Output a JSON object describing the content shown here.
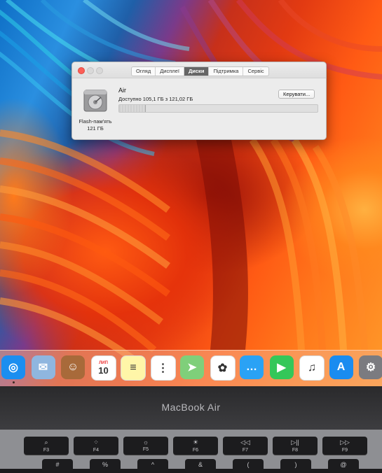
{
  "window": {
    "tabs": [
      "Огляд",
      "Дисплеї",
      "Диски",
      "Підтримка",
      "Сервіс"
    ],
    "active_tab_index": 2,
    "disk": {
      "caption_line1": "Flash-пам'ять",
      "caption_line2": "121 ГБ",
      "name": "Air",
      "available_text": "Доступно 105,1 ГБ з 121,02 ГБ",
      "manage_label": "Керувати...",
      "used_fraction": 0.13
    }
  },
  "dock": {
    "apps": [
      {
        "name": "safari-icon",
        "color": "#1b8ef0",
        "glyph": "◎"
      },
      {
        "name": "mail-icon",
        "color": "#8fb6df",
        "glyph": "✉"
      },
      {
        "name": "contacts-icon",
        "color": "#a86a3a",
        "glyph": "☺"
      },
      {
        "name": "calendar-icon",
        "color": "#ffffff",
        "glyph": "10"
      },
      {
        "name": "notes-icon",
        "color": "#fff6a8",
        "glyph": "≡"
      },
      {
        "name": "reminders-icon",
        "color": "#ffffff",
        "glyph": "⋮"
      },
      {
        "name": "maps-icon",
        "color": "#7fcf7a",
        "glyph": "➤"
      },
      {
        "name": "photos-icon",
        "color": "#ffffff",
        "glyph": "✿"
      },
      {
        "name": "messages-icon",
        "color": "#2aa2f5",
        "glyph": "…"
      },
      {
        "name": "facetime-icon",
        "color": "#34c759",
        "glyph": "▶"
      },
      {
        "name": "itunes-icon",
        "color": "#ffffff",
        "glyph": "♫"
      },
      {
        "name": "app-store-icon",
        "color": "#1a8cf0",
        "glyph": "A"
      },
      {
        "name": "system-preferences-icon",
        "color": "#7b7b80",
        "glyph": "⚙"
      }
    ],
    "calendar_month": "ЛИП",
    "calendar_day": "10"
  },
  "laptop": {
    "brand": "MacBook Air"
  },
  "keyboard": {
    "fkeys": [
      {
        "glyph": "⌕",
        "label": "F3"
      },
      {
        "glyph": "⁘",
        "label": "F4"
      },
      {
        "glyph": "☼",
        "label": "F5"
      },
      {
        "glyph": "☀",
        "label": "F6"
      },
      {
        "glyph": "◁◁",
        "label": "F7"
      },
      {
        "glyph": "▷||",
        "label": "F8"
      },
      {
        "glyph": "▷▷",
        "label": "F9"
      }
    ],
    "row2": [
      "#",
      "%",
      "^",
      "&",
      "(",
      ")",
      "@"
    ]
  }
}
